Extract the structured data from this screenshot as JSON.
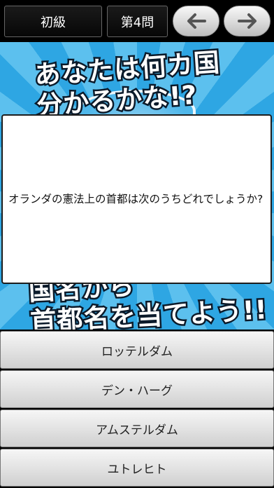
{
  "header": {
    "level_label": "初級",
    "question_number": "第4問",
    "prev_icon": "arrow-left-icon",
    "next_icon": "arrow-right-icon"
  },
  "banner": {
    "headline_top": "あなたは何カ国\n分かるかな!?",
    "headline_bottom": "国名から\n首都名を当てよう!!"
  },
  "question": {
    "text": "オランダの憲法上の首都は次のうちどれでしょうか?"
  },
  "answers": [
    {
      "label": "ロッテルダム"
    },
    {
      "label": "デン・ハーグ"
    },
    {
      "label": "アムステルダム"
    },
    {
      "label": "ユトレヒト"
    }
  ],
  "colors": {
    "banner_light": "#5cc0ee",
    "banner_dark": "#2ea6e3",
    "background": "#000000"
  }
}
